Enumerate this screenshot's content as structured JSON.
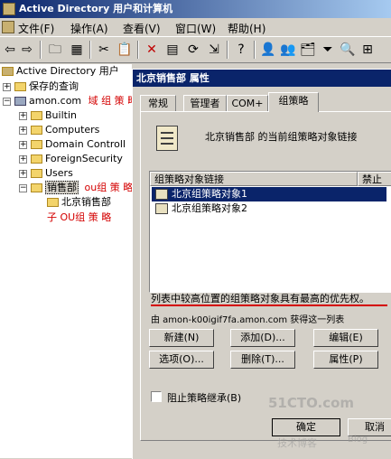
{
  "app": {
    "title": "Active Directory 用户和计算机",
    "menu": [
      "文件(F)",
      "操作(A)",
      "查看(V)",
      "窗口(W)",
      "帮助(H)"
    ]
  },
  "toolbar_icons": [
    "back-icon",
    "forward-icon",
    "up-folder-icon",
    "show-tree-icon",
    "cut-icon",
    "paste-icon",
    "delete-icon",
    "properties-icon",
    "refresh-icon",
    "export-icon",
    "help-icon",
    "add-user-icon",
    "add-group-icon",
    "add-ou-icon",
    "filter-icon",
    "find-icon",
    "add-to-group-icon"
  ],
  "tree": {
    "header": "Active Directory 用户",
    "saved_queries": "保存的查询",
    "domain": "amon.com",
    "domain_note": "域 组 策 略",
    "children": [
      "Builtin",
      "Computers",
      "Domain Controll",
      "ForeignSecurity",
      "Users"
    ],
    "ou": "销售部",
    "ou_note": "ou组 策 略",
    "sub_ou": "北京销售部",
    "sub_ou_note": "子 OU组 策 略"
  },
  "dialog": {
    "title": "北京销售部 属性",
    "tabs": [
      "常规",
      "管理者",
      "COM+",
      "组策略"
    ],
    "active_tab": "组策略",
    "header_text": "北京销售部 的当前组策略对象链接",
    "columns": [
      "组策略对象链接",
      "禁止"
    ],
    "gpo_list": [
      {
        "name": "北京组策略对象1",
        "selected": true
      },
      {
        "name": "北京组策略对象2",
        "selected": false
      }
    ],
    "priority_note": "列表中较高位置的组策略对象具有最高的优先权。",
    "source_note": "由 amon-k00igif7fa.amon.com 获得这一列表",
    "buttons": {
      "new": "新建(N)",
      "add": "添加(D)...",
      "edit": "编辑(E)",
      "options": "选项(O)...",
      "delete": "删除(T)...",
      "properties": "属性(P)"
    },
    "block_inheritance": "阻止策略继承(B)",
    "ok": "确定",
    "cancel": "取消"
  },
  "watermark": {
    "site": "51CTO.com",
    "sub": "技术博客",
    "blog": "Blog"
  },
  "colors": {
    "title_bar": "#0a246a",
    "selection": "#0a246a",
    "annotation": "#d40000",
    "window_face": "#d4d0c8"
  }
}
